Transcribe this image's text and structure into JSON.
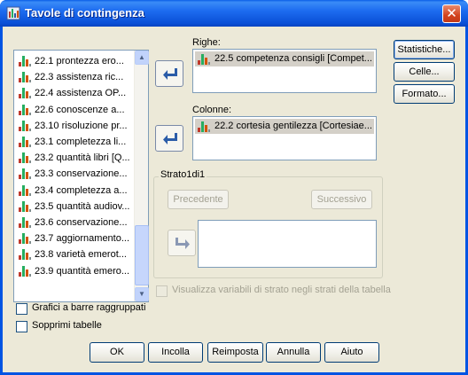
{
  "window": {
    "title": "Tavole di contingenza",
    "close_symbol": "✕"
  },
  "variables": [
    "22.1 prontezza ero...",
    "22.3 assistenza ric...",
    "22.4 assistenza OP...",
    "22.6 conoscenze a...",
    "23.10 risoluzione pr...",
    "23.1 completezza li...",
    "23.2 quantità libri [Q...",
    "23.3 conservazione...",
    "23.4 completezza a...",
    "23.5 quantità audiov...",
    "23.6 conservazione...",
    "23.7 aggiornamento...",
    "23.8 varietà emerot...",
    "23.9 quantità emero..."
  ],
  "scrollbar": {
    "up_symbol": "▲",
    "down_symbol": "▼"
  },
  "rows": {
    "label": "Righe:",
    "items": [
      "22.5 competenza consigli [Compet..."
    ]
  },
  "columns": {
    "label": "Colonne:",
    "items": [
      "22.2 cortesia gentilezza [Cortesiae..."
    ]
  },
  "layer": {
    "title": "Strato1di1",
    "prev_label": "Precedente",
    "next_label": "Successivo"
  },
  "side_buttons": {
    "statistics": "Statistiche...",
    "cells": "Celle...",
    "format": "Formato..."
  },
  "options": {
    "show_layer_vars": "Visualizza variabili di strato negli strati della tabella",
    "clustered_bars": "Grafici a barre raggruppati",
    "suppress_tables": "Sopprimi tabelle"
  },
  "bottom_buttons": {
    "ok": "OK",
    "paste": "Incolla",
    "reset": "Reimposta",
    "cancel": "Annulla",
    "help": "Aiuto"
  }
}
